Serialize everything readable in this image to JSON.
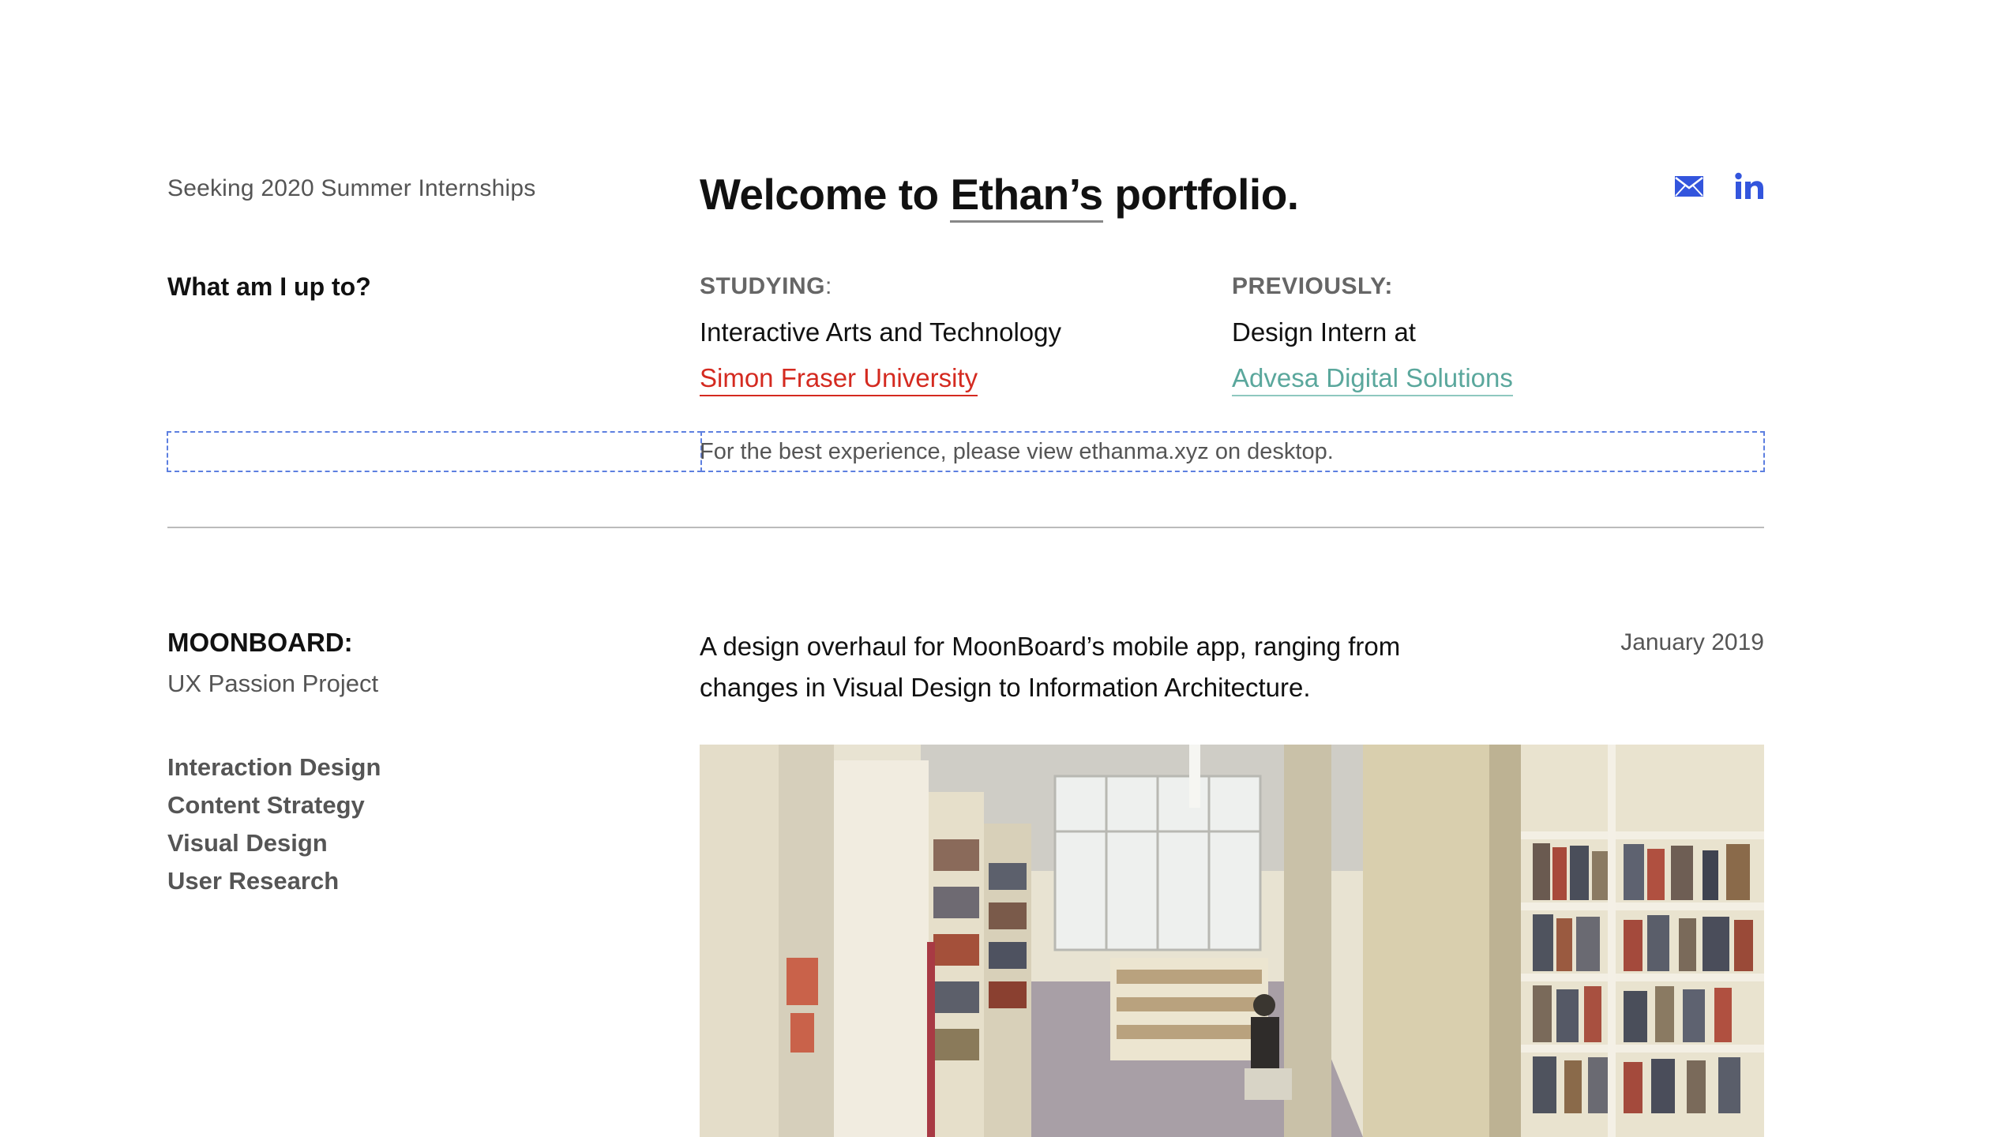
{
  "header": {
    "seeking": "Seeking 2020 Summer Internships",
    "welcome_prefix": "Welcome to ",
    "welcome_name": "Ethan’s",
    "welcome_suffix": " portfolio.",
    "social": [
      {
        "icon": "mail-icon"
      },
      {
        "icon": "linkedin-icon"
      }
    ]
  },
  "intro": {
    "heading": "What am I up to?",
    "studying": {
      "label": "STUDYING",
      "colon": ":",
      "line": "Interactive Arts and Technology",
      "link": "Simon Fraser University"
    },
    "previously": {
      "label": "PREVIOUSLY:",
      "line": "Design Intern at",
      "link": "Advesa Digital Solutions"
    }
  },
  "notice": "For the best experience, please view ethanma.xyz on desktop.",
  "project": {
    "title": "MOONBOARD:",
    "subtitle": "UX Passion Project",
    "description": "A design overhaul for MoonBoard’s mobile app, ranging from changes in Visual Design to Information Architecture.",
    "date": "January 2019",
    "tags": [
      "Interaction Design",
      "Content Strategy",
      "Visual Design",
      "User Research"
    ]
  },
  "colors": {
    "accent_blue": "#3355dd",
    "sfu_red": "#d42a20",
    "advesa_teal": "#5aa79c"
  }
}
